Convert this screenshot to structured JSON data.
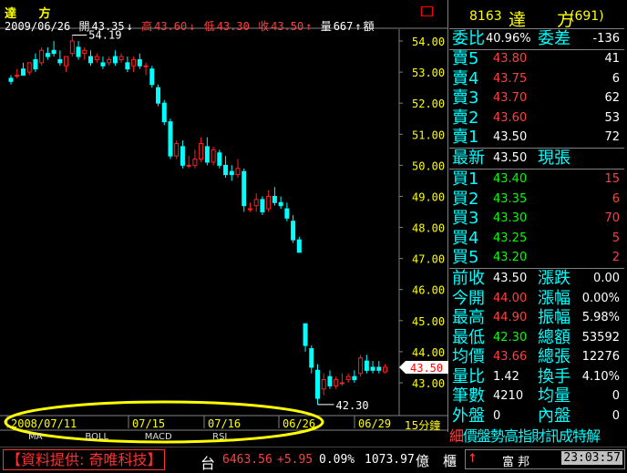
{
  "chart": {
    "stock_title": "達 方",
    "ohlc": {
      "date": "2009/06/26",
      "open_label": "開",
      "open": "43.35",
      "high_label": "高",
      "high": "43.60",
      "low_label": "低",
      "low": "43.30",
      "close_label": "收",
      "close": "43.50",
      "vol_label": "量",
      "vol": "667",
      "amount_label": "額"
    },
    "high_mark": "54.19",
    "low_mark": "42.30",
    "current_price_tag": "43.50",
    "period": "15分鐘",
    "indicator_tabs": [
      "MA",
      "BOLL",
      "MACD",
      "RSI"
    ],
    "colors": {
      "up": "#ff2020",
      "down": "#00ffff",
      "grid": "#808080",
      "axis_text": "#ffff00"
    }
  },
  "chart_data": {
    "type": "candlestick",
    "title": "",
    "y_ticks": [
      "54.00",
      "53.00",
      "52.00",
      "51.00",
      "50.00",
      "49.00",
      "48.00",
      "47.00",
      "46.00",
      "45.00",
      "44.00",
      "43.00"
    ],
    "ylim": [
      42.2,
      54.8
    ],
    "x_ticks": [
      "2008/07/11",
      "07/15",
      "07/16",
      "06/26",
      "06/29"
    ],
    "candles": [
      {
        "o": 52.8,
        "h": 52.9,
        "c": 52.7,
        "l": 52.6
      },
      {
        "o": 52.9,
        "h": 53.1,
        "c": 52.9,
        "l": 52.8
      },
      {
        "o": 53.1,
        "h": 53.3,
        "c": 52.9,
        "l": 52.9
      },
      {
        "o": 53.0,
        "h": 53.3,
        "c": 53.3,
        "l": 52.9
      },
      {
        "o": 53.4,
        "h": 53.6,
        "c": 53.1,
        "l": 53.0
      },
      {
        "o": 53.3,
        "h": 53.8,
        "c": 53.7,
        "l": 53.2
      },
      {
        "o": 53.6,
        "h": 53.8,
        "c": 53.5,
        "l": 53.4
      },
      {
        "o": 53.7,
        "h": 54.0,
        "c": 53.6,
        "l": 53.5
      },
      {
        "o": 53.4,
        "h": 53.7,
        "c": 53.3,
        "l": 53.2
      },
      {
        "o": 53.2,
        "h": 53.4,
        "c": 53.5,
        "l": 53.0
      },
      {
        "o": 53.6,
        "h": 54.19,
        "c": 54.0,
        "l": 53.5
      },
      {
        "o": 53.8,
        "h": 54.0,
        "c": 53.5,
        "l": 53.4
      },
      {
        "o": 53.6,
        "h": 53.8,
        "c": 53.7,
        "l": 53.4
      },
      {
        "o": 53.5,
        "h": 53.7,
        "c": 53.3,
        "l": 53.2
      },
      {
        "o": 53.4,
        "h": 53.6,
        "c": 53.5,
        "l": 53.3
      },
      {
        "o": 53.3,
        "h": 53.5,
        "c": 53.2,
        "l": 53.1
      },
      {
        "o": 53.3,
        "h": 53.5,
        "c": 53.4,
        "l": 53.2
      },
      {
        "o": 53.5,
        "h": 53.7,
        "c": 53.3,
        "l": 53.2
      },
      {
        "o": 53.4,
        "h": 53.6,
        "c": 53.5,
        "l": 53.3
      },
      {
        "o": 53.3,
        "h": 53.5,
        "c": 53.1,
        "l": 53.0
      },
      {
        "o": 53.2,
        "h": 53.5,
        "c": 53.4,
        "l": 53.0
      },
      {
        "o": 53.4,
        "h": 53.6,
        "c": 53.2,
        "l": 53.1
      },
      {
        "o": 53.2,
        "h": 53.3,
        "c": 53.2,
        "l": 52.9
      },
      {
        "o": 53.1,
        "h": 53.2,
        "c": 52.6,
        "l": 52.5
      },
      {
        "o": 52.5,
        "h": 52.6,
        "c": 52.0,
        "l": 51.9
      },
      {
        "o": 52.0,
        "h": 52.1,
        "c": 51.4,
        "l": 51.3
      },
      {
        "o": 51.4,
        "h": 51.5,
        "c": 50.3,
        "l": 50.2
      },
      {
        "o": 50.3,
        "h": 50.8,
        "c": 50.7,
        "l": 50.2
      },
      {
        "o": 50.6,
        "h": 50.8,
        "c": 50.0,
        "l": 49.9
      },
      {
        "o": 50.0,
        "h": 50.3,
        "c": 50.0,
        "l": 49.9
      },
      {
        "o": 50.0,
        "h": 50.5,
        "c": 50.2,
        "l": 49.9
      },
      {
        "o": 50.2,
        "h": 50.9,
        "c": 50.7,
        "l": 50.1
      },
      {
        "o": 50.6,
        "h": 50.9,
        "c": 50.1,
        "l": 50.0
      },
      {
        "o": 50.1,
        "h": 50.6,
        "c": 50.5,
        "l": 50.0
      },
      {
        "o": 50.4,
        "h": 50.5,
        "c": 50.0,
        "l": 49.9
      },
      {
        "o": 50.0,
        "h": 50.3,
        "c": 49.7,
        "l": 49.6
      },
      {
        "o": 49.8,
        "h": 50.0,
        "c": 49.7,
        "l": 49.5
      },
      {
        "o": 49.7,
        "h": 50.2,
        "c": 49.9,
        "l": 49.6
      },
      {
        "o": 49.8,
        "h": 49.9,
        "c": 48.7,
        "l": 48.5
      },
      {
        "o": 48.6,
        "h": 48.8,
        "c": 48.6,
        "l": 48.5
      },
      {
        "o": 48.7,
        "h": 49.1,
        "c": 48.9,
        "l": 48.5
      },
      {
        "o": 48.9,
        "h": 49.0,
        "c": 48.5,
        "l": 48.4
      },
      {
        "o": 48.6,
        "h": 49.2,
        "c": 49.0,
        "l": 48.5
      },
      {
        "o": 49.0,
        "h": 49.3,
        "c": 48.8,
        "l": 48.7
      },
      {
        "o": 48.8,
        "h": 49.0,
        "c": 48.7,
        "l": 48.6
      },
      {
        "o": 48.6,
        "h": 48.8,
        "c": 48.3,
        "l": 48.2
      },
      {
        "o": 48.2,
        "h": 48.4,
        "c": 47.6,
        "l": 47.5
      },
      {
        "o": 47.6,
        "h": 47.7,
        "c": 47.2,
        "l": 47.2
      },
      {
        "o": 44.9,
        "h": 44.9,
        "c": 44.2,
        "l": 44.0
      },
      {
        "o": 44.1,
        "h": 44.2,
        "c": 43.5,
        "l": 43.3
      },
      {
        "o": 43.4,
        "h": 43.6,
        "c": 42.5,
        "l": 42.3
      },
      {
        "o": 42.8,
        "h": 43.3,
        "c": 43.1,
        "l": 42.6
      },
      {
        "o": 43.2,
        "h": 43.4,
        "c": 42.9,
        "l": 42.8
      },
      {
        "o": 42.9,
        "h": 43.2,
        "c": 43.1,
        "l": 42.8
      },
      {
        "o": 43.0,
        "h": 43.3,
        "c": 43.0,
        "l": 42.9
      },
      {
        "o": 43.1,
        "h": 43.3,
        "c": 43.2,
        "l": 43.0
      },
      {
        "o": 43.2,
        "h": 43.4,
        "c": 43.1,
        "l": 43.0
      },
      {
        "o": 43.3,
        "h": 43.9,
        "c": 43.8,
        "l": 43.2
      },
      {
        "o": 43.7,
        "h": 43.9,
        "c": 43.4,
        "l": 43.3
      },
      {
        "o": 43.5,
        "h": 43.7,
        "c": 43.4,
        "l": 43.3
      },
      {
        "o": 43.5,
        "h": 43.7,
        "c": 43.4,
        "l": 43.3
      },
      {
        "o": 43.35,
        "h": 43.6,
        "c": 43.5,
        "l": 43.3
      }
    ]
  },
  "quote": {
    "code": "8163",
    "name": "達 方",
    "count": "(691)",
    "ratio_label": "委比",
    "ratio_value": "40.96%",
    "diff_label": "委差",
    "diff_value": "-136",
    "asks": [
      {
        "label": "賣5",
        "price": "43.80",
        "vol": "41"
      },
      {
        "label": "賣4",
        "price": "43.75",
        "vol": "6"
      },
      {
        "label": "賣3",
        "price": "43.70",
        "vol": "62"
      },
      {
        "label": "賣2",
        "price": "43.60",
        "vol": "53"
      },
      {
        "label": "賣1",
        "price": "43.50",
        "vol": "72"
      }
    ],
    "latest_label": "最新",
    "latest_price": "43.50",
    "now_label": "現張",
    "bids": [
      {
        "label": "買1",
        "price": "43.40",
        "vol": "15"
      },
      {
        "label": "買2",
        "price": "43.35",
        "vol": "6"
      },
      {
        "label": "買3",
        "price": "43.30",
        "vol": "70"
      },
      {
        "label": "買4",
        "price": "43.25",
        "vol": "5"
      },
      {
        "label": "買5",
        "price": "43.20",
        "vol": "2"
      }
    ],
    "stats": [
      {
        "l1": "前收",
        "v1": "43.50",
        "c1": "white",
        "l2": "漲跌",
        "v2": "0.00",
        "c2": "white"
      },
      {
        "l1": "今開",
        "v1": "44.00",
        "c1": "red",
        "l2": "漲幅",
        "v2": "0.00%",
        "c2": "white"
      },
      {
        "l1": "最高",
        "v1": "44.90",
        "c1": "red",
        "l2": "振幅",
        "v2": "5.98%",
        "c2": "white"
      },
      {
        "l1": "最低",
        "v1": "42.30",
        "c1": "green",
        "l2": "總額",
        "v2": "53592",
        "c2": "white"
      },
      {
        "l1": "均價",
        "v1": "43.66",
        "c1": "red",
        "l2": "總張",
        "v2": "12276",
        "c2": "white"
      },
      {
        "l1": "量比",
        "v1": "1.42",
        "c1": "white",
        "l2": "換手",
        "v2": "4.10%",
        "c2": "white"
      },
      {
        "l1": "筆數",
        "v1": "4210",
        "c1": "white",
        "l2": "均量",
        "v2": "0",
        "c2": "white"
      },
      {
        "l1": "外盤",
        "v1": "0",
        "c1": "white",
        "l2": "內盤",
        "v2": "0",
        "c2": "white"
      }
    ],
    "menu": [
      "細",
      "價",
      "盤",
      "勢",
      "高",
      "指",
      "財",
      "訊",
      "成",
      "特",
      "解"
    ]
  },
  "bottom": {
    "provider": "【資料提供: 奇唯科技】",
    "index_label": "台",
    "index_value": "6463.56",
    "index_change": "+5.95",
    "index_pct": "0.09%",
    "index_amount": "1073.97",
    "unit": "億",
    "unit2": "櫃",
    "arrow": "↑",
    "broker": "富 邦",
    "time": "23:03:57"
  }
}
